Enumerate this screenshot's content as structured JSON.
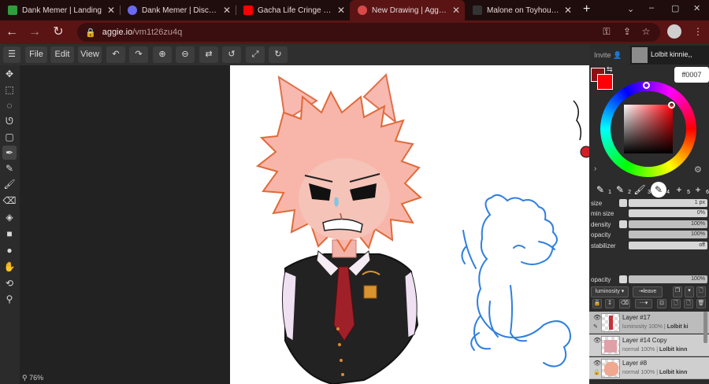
{
  "browser": {
    "tabs": [
      {
        "title": "Dank Memer | Landing",
        "favicon": "dank-memer-favicon",
        "color": "#2e9e3e",
        "active": false
      },
      {
        "title": "Dank Memer | Discord Bots",
        "favicon": "discord-favicon",
        "color": "#6a6af0",
        "active": false
      },
      {
        "title": "Gacha Life Cringe has gone way",
        "favicon": "youtube-favicon",
        "color": "#ff0000",
        "active": false
      },
      {
        "title": "New Drawing | Aggie.io",
        "favicon": "aggie-favicon",
        "color": "#d84a4a",
        "active": true
      },
      {
        "title": "Malone on Toyhouse",
        "favicon": "toyhouse-favicon",
        "color": "#333333",
        "active": false
      }
    ],
    "new_tab": "+",
    "url_host": "aggie.io",
    "url_path": "/vm1t26zu4q",
    "win_controls": [
      "⌄",
      "–",
      "▢",
      "✕"
    ]
  },
  "app": {
    "toolbar": {
      "file": "File",
      "edit": "Edit",
      "view": "View"
    },
    "zoom": "76%",
    "invite": "Invite",
    "username": "Lolbit kinnie,,",
    "color_hex": "ff0007",
    "primary_color": "#ff0007",
    "secondary_color": "#8b1015",
    "brush_slots": [
      "1",
      "2",
      "3",
      "4",
      "5",
      "6"
    ],
    "props": {
      "size_label": "size",
      "size_value": "1 px",
      "min_size_label": "min size",
      "min_size_value": "0%",
      "density_label": "density",
      "density_value": "100%",
      "opacity_label": "opacity",
      "opacity_value": "100%",
      "stabilizer_label": "stabilizer",
      "stabilizer_value": "off"
    },
    "layer_opacity_label": "opacity",
    "layer_opacity_value": "100%",
    "blend_mode": "luminosity",
    "leave_label": "leave",
    "layers": [
      {
        "name": "Layer #17",
        "blend": "luminosity 100%",
        "owner": "Lolbit ki",
        "selected": true
      },
      {
        "name": "Layer #14 Copy",
        "blend": "normal 100%",
        "owner": "Lolbit kinn",
        "selected": false
      },
      {
        "name": "Layer #8",
        "blend": "normal 100%",
        "owner": "Lolbit kinn",
        "selected": false
      }
    ]
  }
}
